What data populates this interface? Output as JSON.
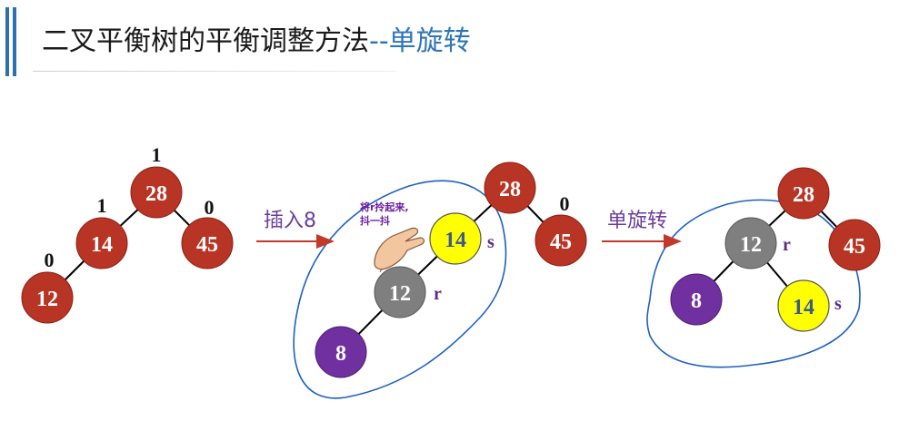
{
  "header": {
    "title": "二叉平衡树的平衡调整方法",
    "subtitle": "--单旋转"
  },
  "colors": {
    "red_node": "#b83525",
    "gray_node": "#7f7f7f",
    "yellow_node": "#ffff00",
    "purple_node": "#7030a0",
    "accent_blue": "#2e75b6",
    "arrow": "#c0392b",
    "outline": "#1f5fbf"
  },
  "arrows": [
    {
      "label": "插入8"
    },
    {
      "label": "单旋转"
    }
  ],
  "annotation": {
    "line1": "将r拎起来,",
    "line2": "抖一抖",
    "hand_icon": "hand-icon"
  },
  "trees": [
    {
      "name": "tree-before",
      "nodes": [
        {
          "id": "n28",
          "label": "28",
          "color": "red",
          "bf": "1"
        },
        {
          "id": "n14",
          "label": "14",
          "color": "red",
          "bf": "1"
        },
        {
          "id": "n45",
          "label": "45",
          "color": "red",
          "bf": "0"
        },
        {
          "id": "n12",
          "label": "12",
          "color": "red",
          "bf": "0"
        }
      ]
    },
    {
      "name": "tree-inserted",
      "nodes": [
        {
          "id": "m28",
          "label": "28",
          "color": "red"
        },
        {
          "id": "m14",
          "label": "14",
          "color": "yellow",
          "tag": "s"
        },
        {
          "id": "m45",
          "label": "45",
          "color": "red",
          "bf": "0"
        },
        {
          "id": "m12",
          "label": "12",
          "color": "gray",
          "tag": "r"
        },
        {
          "id": "m8",
          "label": "8",
          "color": "purple"
        }
      ]
    },
    {
      "name": "tree-rotated",
      "nodes": [
        {
          "id": "k28",
          "label": "28",
          "color": "red"
        },
        {
          "id": "k12",
          "label": "12",
          "color": "gray",
          "tag": "r"
        },
        {
          "id": "k45",
          "label": "45",
          "color": "red"
        },
        {
          "id": "k8",
          "label": "8",
          "color": "purple"
        },
        {
          "id": "k14",
          "label": "14",
          "color": "yellow",
          "tag": "s"
        }
      ]
    }
  ]
}
